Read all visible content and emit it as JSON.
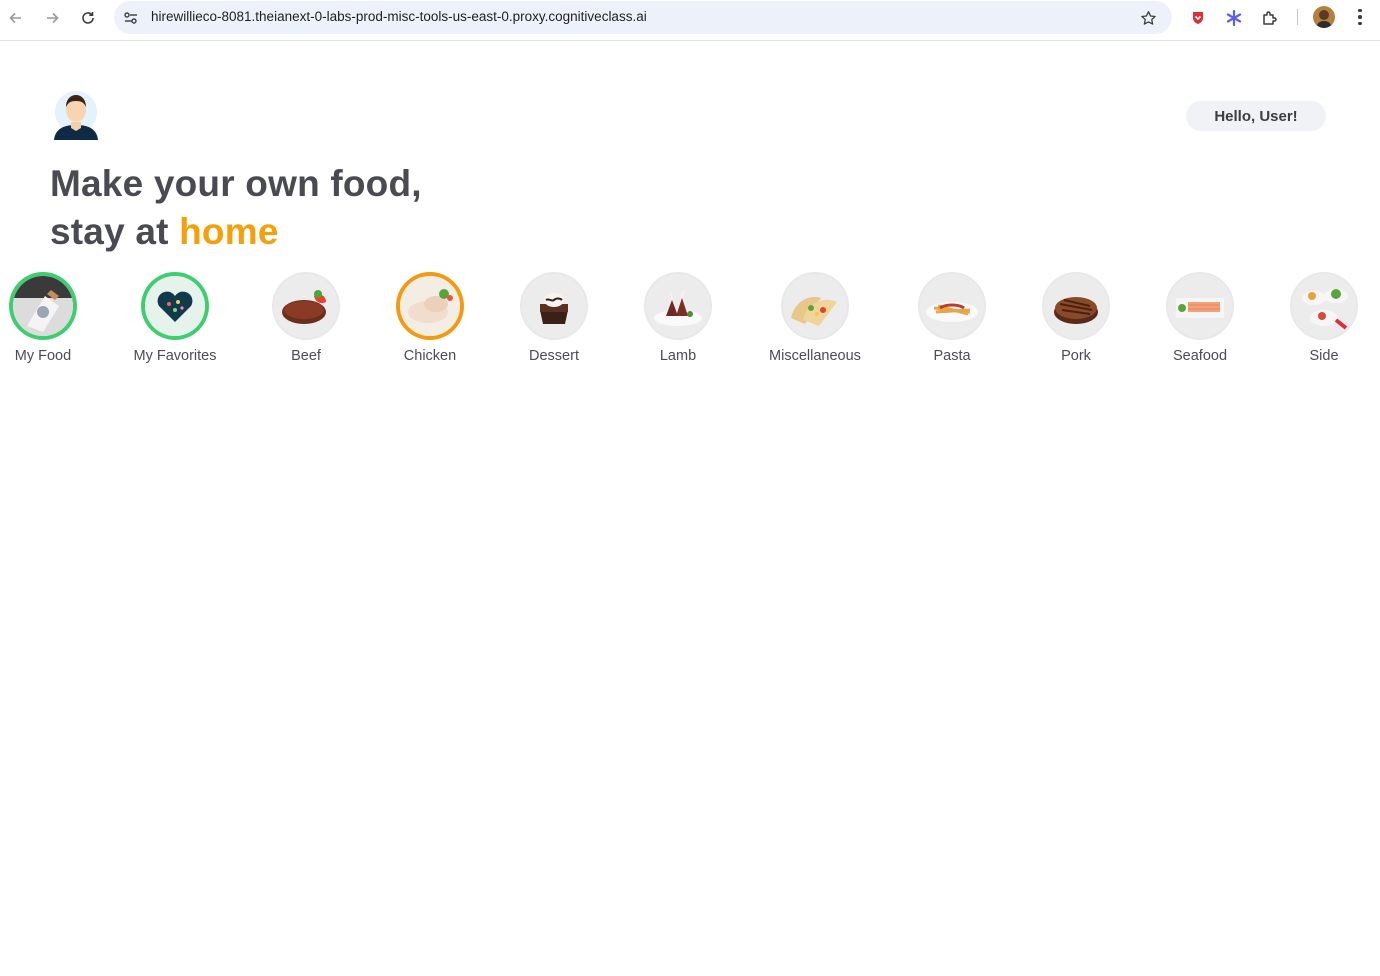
{
  "browser": {
    "url": "hirewillieco-8081.theianext-0-labs-prod-misc-tools-us-east-0.proxy.cognitiveclass.ai"
  },
  "header": {
    "greeting": "Hello, User!",
    "headline_line1": "Make your own food,",
    "headline_line2_prefix": "stay at ",
    "headline_accent": "home",
    "accent_color": "#f5a00a"
  },
  "categories": [
    {
      "label": "My Food",
      "ring": "green"
    },
    {
      "label": "My Favorites",
      "ring": "green"
    },
    {
      "label": "Beef",
      "ring": "plain"
    },
    {
      "label": "Chicken",
      "ring": "orange"
    },
    {
      "label": "Dessert",
      "ring": "plain"
    },
    {
      "label": "Lamb",
      "ring": "plain"
    },
    {
      "label": "Miscellaneous",
      "ring": "plain"
    },
    {
      "label": "Pasta",
      "ring": "plain"
    },
    {
      "label": "Pork",
      "ring": "plain"
    },
    {
      "label": "Seafood",
      "ring": "plain"
    },
    {
      "label": "Side",
      "ring": "plain"
    }
  ]
}
